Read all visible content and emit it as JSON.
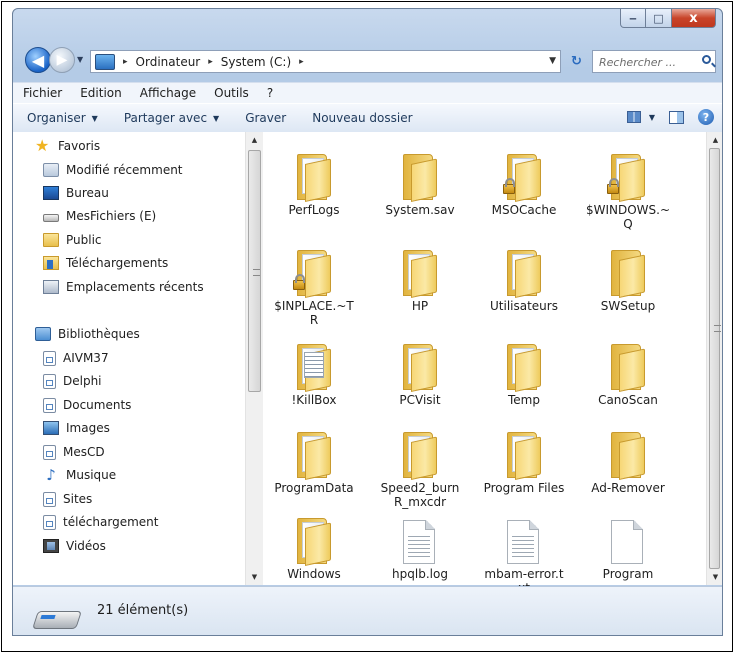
{
  "window": {
    "min_glyph": "‒",
    "max_glyph": "□",
    "close_glyph": "x"
  },
  "address": {
    "back_glyph": "◀",
    "forward_glyph": "▶",
    "crumbs": [
      "Ordinateur",
      "System (C:)"
    ],
    "separator": "▸",
    "search_placeholder": "Rechercher ..."
  },
  "menubar": {
    "items": [
      "Fichier",
      "Edition",
      "Affichage",
      "Outils",
      "?"
    ]
  },
  "toolbar": {
    "organize_label": "Organiser",
    "share_label": "Partager avec",
    "burn_label": "Graver",
    "new_folder_label": "Nouveau dossier",
    "help_glyph": "?"
  },
  "navpane": {
    "favorites_label": "Favoris",
    "favorites": [
      "Modifié récemment",
      "Bureau",
      "MesFichiers (E)",
      "Public",
      "Téléchargements",
      "Emplacements récents"
    ],
    "libraries_label": "Bibliothèques",
    "libraries": [
      "AIVM37",
      "Delphi",
      "Documents",
      "Images",
      "MesCD",
      "Musique",
      "Sites",
      "téléchargement",
      "Vidéos"
    ]
  },
  "files": [
    {
      "name": "PerfLogs",
      "kind": "folder",
      "locked": false
    },
    {
      "name": "System.sav",
      "kind": "folder-empty",
      "locked": false
    },
    {
      "name": "MSOCache",
      "kind": "folder",
      "locked": true
    },
    {
      "name": "$WINDOWS.~Q",
      "kind": "folder",
      "locked": true
    },
    {
      "name": "$INPLACE.~TR",
      "kind": "folder",
      "locked": true
    },
    {
      "name": "HP",
      "kind": "folder",
      "locked": false
    },
    {
      "name": "Utilisateurs",
      "kind": "folder",
      "locked": false
    },
    {
      "name": "SWSetup",
      "kind": "folder-empty",
      "locked": false
    },
    {
      "name": "!KillBox",
      "kind": "folder-list",
      "locked": false
    },
    {
      "name": "PCVisit",
      "kind": "folder",
      "locked": false
    },
    {
      "name": "Temp",
      "kind": "folder",
      "locked": false
    },
    {
      "name": "CanoScan",
      "kind": "folder-empty",
      "locked": false
    },
    {
      "name": "ProgramData",
      "kind": "folder",
      "locked": false
    },
    {
      "name": "Speed2_burnR_mxcdr",
      "kind": "folder",
      "locked": false
    },
    {
      "name": "Program Files",
      "kind": "folder",
      "locked": false
    },
    {
      "name": "Ad-Remover",
      "kind": "folder-empty",
      "locked": false
    },
    {
      "name": "Windows",
      "kind": "folder",
      "locked": false
    },
    {
      "name": "hpqlb.log",
      "kind": "text",
      "locked": false
    },
    {
      "name": "mbam-error.txt",
      "kind": "text",
      "locked": false
    },
    {
      "name": "Program",
      "kind": "blank",
      "locked": false
    }
  ],
  "status": {
    "count_text": "21 élément(s)"
  }
}
